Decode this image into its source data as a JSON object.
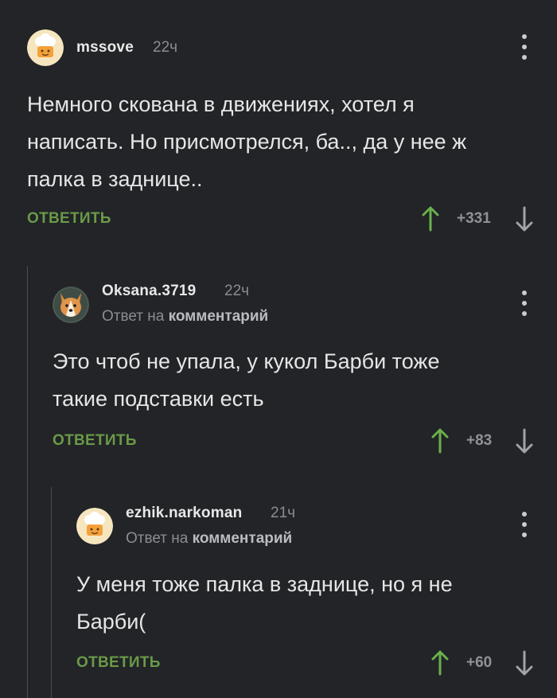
{
  "comments": [
    {
      "username": "mssove",
      "time": "22ч",
      "text_lines": [
        "Немного скована в движениях, хотел я",
        "написать. Но присмотрелся, ба.., да у нее ж",
        "палка в заднице.."
      ],
      "reply_label": "ОТВЕТИТЬ",
      "score": "+331",
      "avatar": "chef-hat-avatar"
    },
    {
      "username": "Oksana.3719",
      "time": "22ч",
      "reply_prefix": "Ответ на",
      "reply_link": "комментарий",
      "text_lines": [
        "Это чтоб не упала, у кукол Барби тоже",
        "такие подставки есть"
      ],
      "reply_label": "ОТВЕТИТЬ",
      "score": "+83",
      "avatar": "corgi-dog-avatar"
    },
    {
      "username": "ezhik.narkoman",
      "time": "21ч",
      "reply_prefix": "Ответ на",
      "reply_link": "комментарий",
      "text_lines": [
        "У меня тоже палка в заднице, но я не",
        "Барби("
      ],
      "reply_label": "ОТВЕТИТЬ",
      "score": "+60",
      "avatar": "chef-hat-avatar"
    }
  ],
  "colors": {
    "background": "#222427",
    "reply_green": "#6a9a48",
    "upvote_green": "#6ab04c",
    "muted": "#8a8d91"
  }
}
